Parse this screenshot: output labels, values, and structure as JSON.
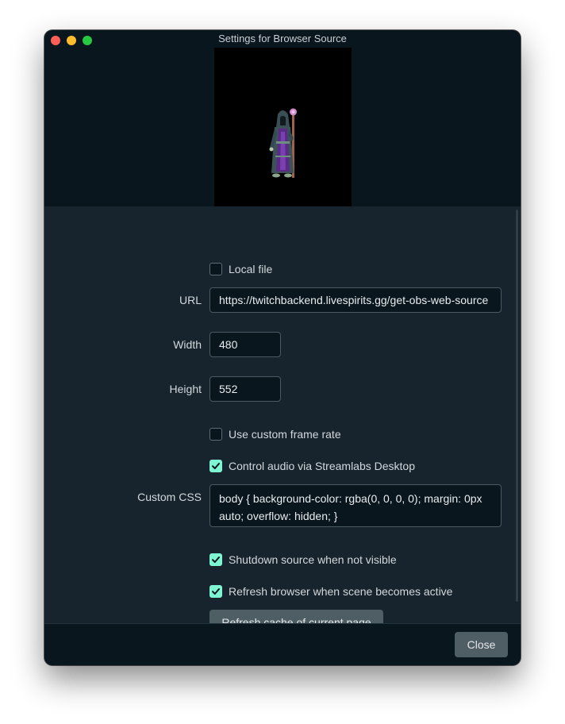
{
  "window": {
    "title": "Settings for Browser Source"
  },
  "form": {
    "local_file": {
      "label": "Local file",
      "checked": false
    },
    "url": {
      "label": "URL",
      "value": "https://twitchbackend.livespirits.gg/get-obs-web-source"
    },
    "width": {
      "label": "Width",
      "value": "480"
    },
    "height": {
      "label": "Height",
      "value": "552"
    },
    "custom_frame_rate": {
      "label": "Use custom frame rate",
      "checked": false
    },
    "control_audio": {
      "label": "Control audio via Streamlabs Desktop",
      "checked": true
    },
    "custom_css": {
      "label": "Custom CSS",
      "value": "body { background-color: rgba(0, 0, 0, 0); margin: 0px auto; overflow: hidden; }"
    },
    "shutdown_source": {
      "label": "Shutdown source when not visible",
      "checked": true
    },
    "refresh_browser": {
      "label": "Refresh browser when scene becomes active",
      "checked": true
    },
    "refresh_cache_label": "Refresh cache of current page"
  },
  "footer": {
    "close_label": "Close"
  },
  "colors": {
    "accent": "#80f5d2",
    "background": "#17242d",
    "panel": "#09161d",
    "button": "#4f5e65"
  },
  "icons": [
    "close-traffic-light",
    "minimize-traffic-light",
    "maximize-traffic-light",
    "checkmark-icon"
  ]
}
